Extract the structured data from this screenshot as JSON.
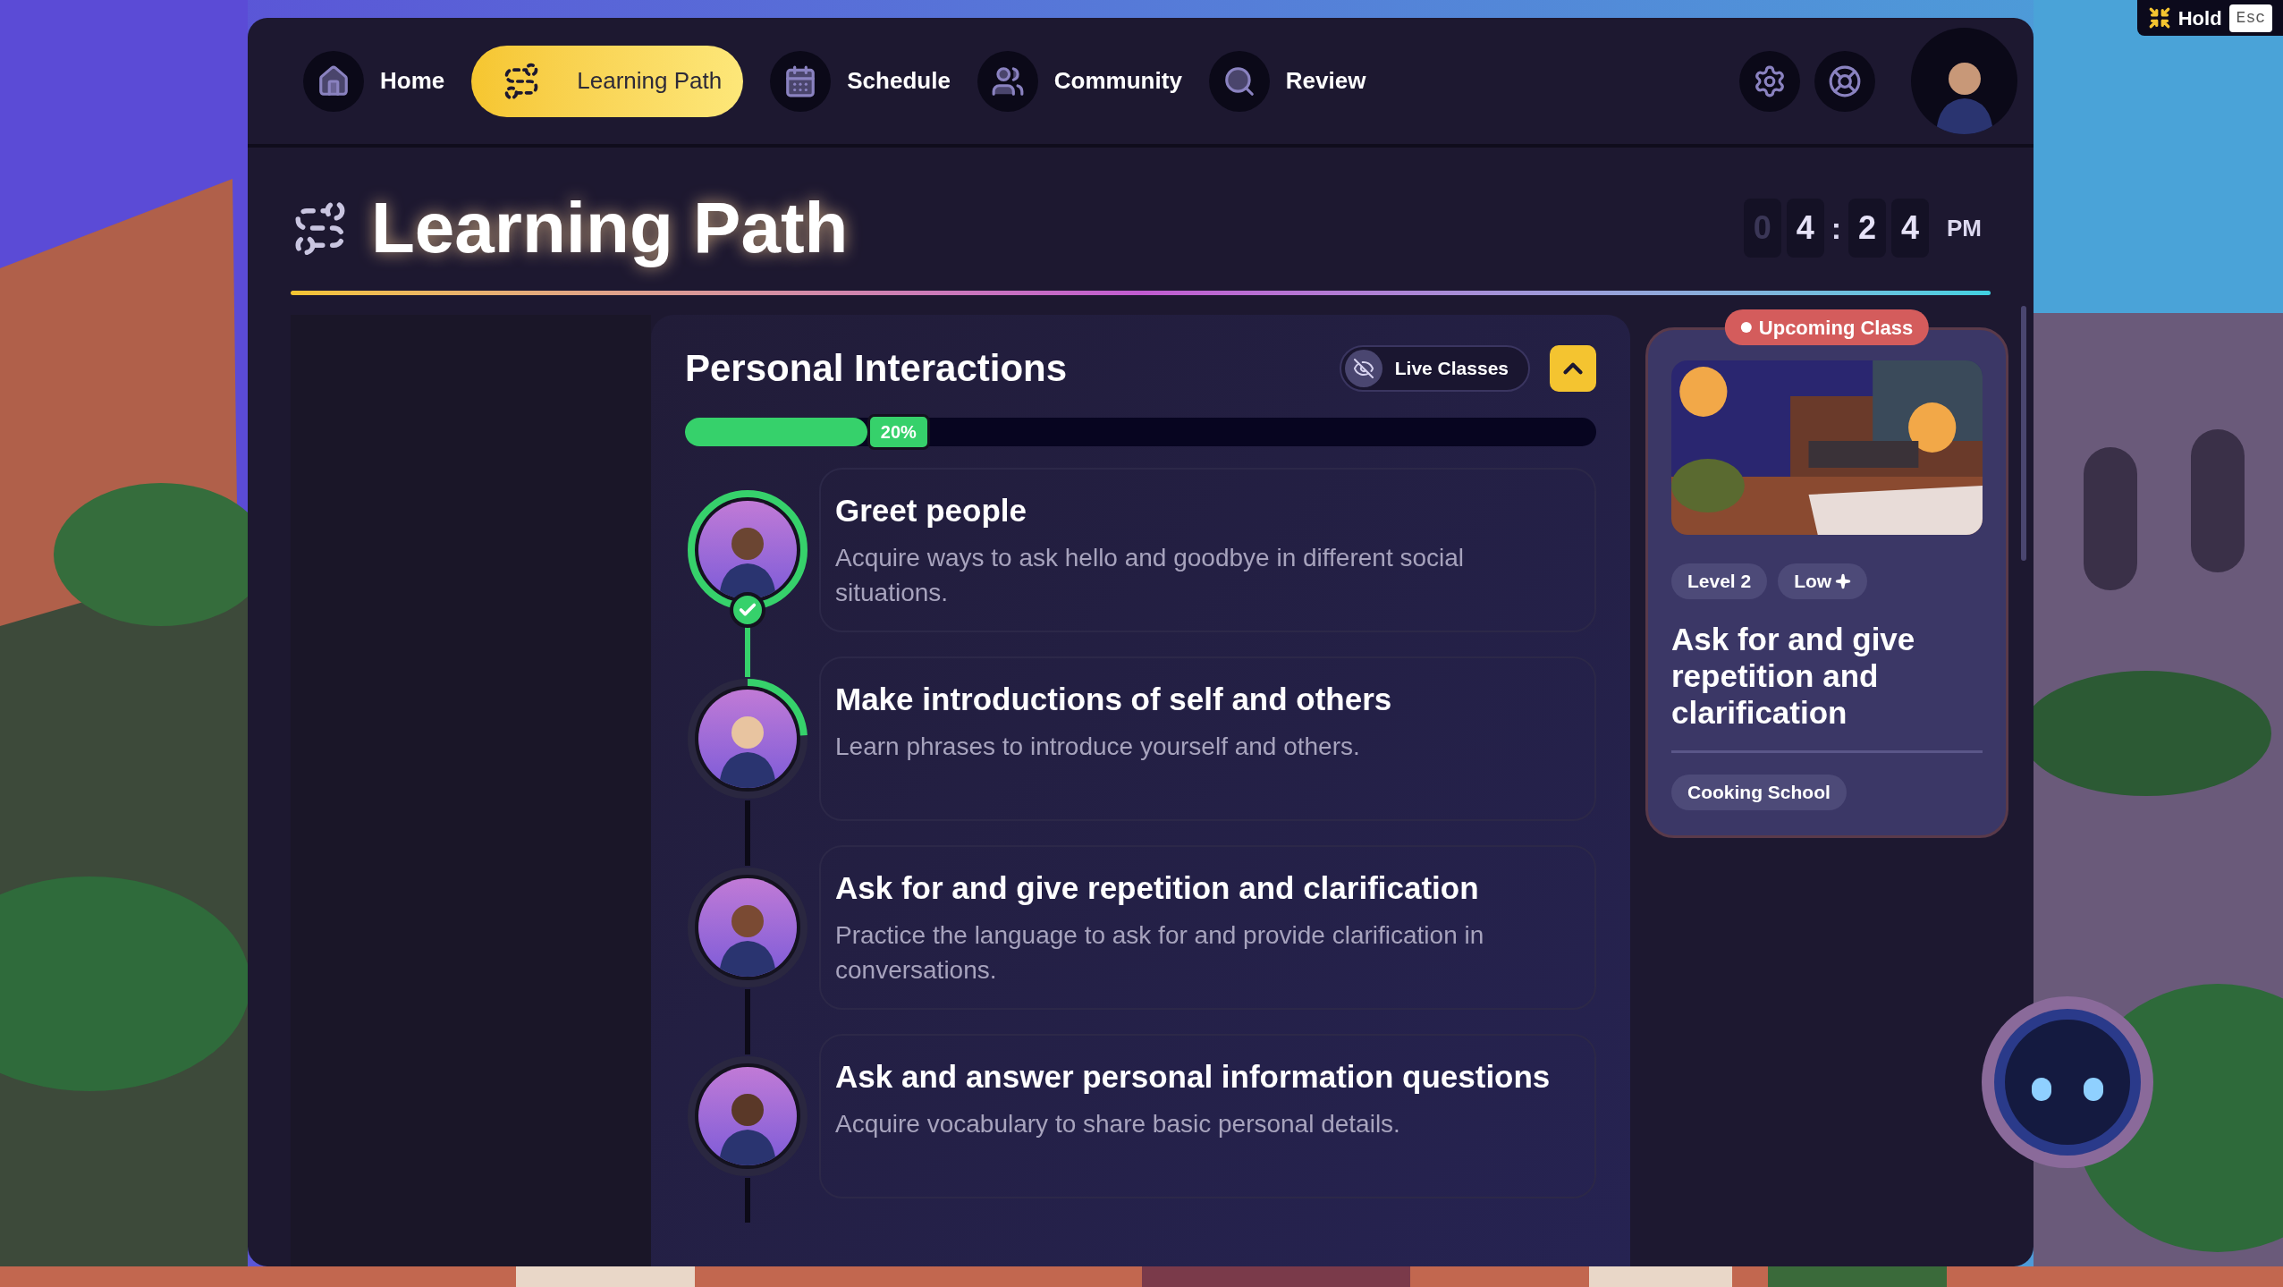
{
  "hold_hint": {
    "label": "Hold",
    "key": "Esc"
  },
  "nav": {
    "items": [
      {
        "label": "Home",
        "selected": false
      },
      {
        "label": "Learning Path",
        "selected": true
      },
      {
        "label": "Schedule",
        "selected": false
      },
      {
        "label": "Community",
        "selected": false
      },
      {
        "label": "Review",
        "selected": false
      }
    ]
  },
  "page": {
    "title": "Learning Path"
  },
  "clock": {
    "digits": [
      {
        "text": "0",
        "dimmed": true
      },
      {
        "text": "4",
        "dimmed": false
      },
      {
        "text": "2",
        "dimmed": false
      },
      {
        "text": "4",
        "dimmed": false
      }
    ],
    "separator": ":",
    "period": "PM"
  },
  "unit": {
    "title": "Personal Interactions",
    "live_classes": {
      "label": "Live Classes",
      "on": false
    },
    "expanded": true,
    "progress": {
      "level": 0.2,
      "text": "20%"
    },
    "lessons": [
      {
        "title": "Greet people",
        "description": "Acquire ways to ask hello and goodbye in different social situations.",
        "kind": "completed"
      },
      {
        "title": "Make introductions of self and others",
        "description": "Learn phrases to introduce yourself and others.",
        "kind": "in_progress"
      },
      {
        "title": "Ask for and give repetition and clarification",
        "description": "Practice the language to ask for and provide clarification in conversations.",
        "kind": "locked"
      },
      {
        "title": "Ask and answer personal information questions",
        "description": "Acquire vocabulary to share basic personal details.",
        "kind": "locked"
      }
    ]
  },
  "upcoming_class": {
    "badge": "Upcoming Class",
    "tags": [
      "Level 2",
      "Low"
    ],
    "title": "Ask for and give repetition and clarification",
    "location": "Cooking School"
  }
}
